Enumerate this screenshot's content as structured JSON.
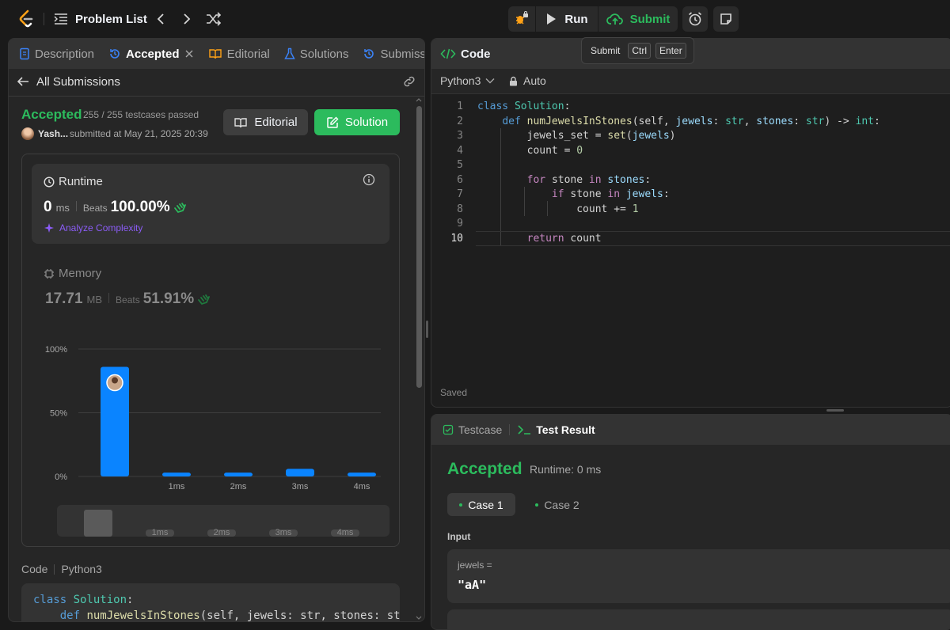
{
  "topbar": {
    "problem_list": "Problem List",
    "run": "Run",
    "submit": "Submit",
    "tooltip": {
      "label": "Submit",
      "key1": "Ctrl",
      "key2": "Enter"
    }
  },
  "left": {
    "tabs": {
      "description": "Description",
      "accepted": "Accepted",
      "editorial": "Editorial",
      "solutions": "Solutions",
      "submissions": "Submissio"
    },
    "all_submissions": "All Submissions",
    "status": "Accepted",
    "testcases": "255 / 255 testcases passed",
    "user": "Yash...",
    "submitted_at": "submitted at May 21, 2025 20:39",
    "editorial_btn": "Editorial",
    "solution_btn": "Solution",
    "runtime": {
      "label": "Runtime",
      "value": "0",
      "unit": "ms",
      "beats_label": "Beats",
      "beats": "100.00%",
      "analyze": "Analyze Complexity"
    },
    "memory": {
      "label": "Memory",
      "value": "17.71",
      "unit": "MB",
      "beats_label": "Beats",
      "beats": "51.91%"
    },
    "code_label": "Code",
    "code_lang": "Python3",
    "code_preview": [
      "class Solution:",
      "    def numJewelsInStones(self, jewels: str, stones: str"
    ]
  },
  "chart_data": {
    "type": "bar",
    "categories": [
      "",
      "1ms",
      "2ms",
      "3ms",
      "4ms"
    ],
    "values": [
      86,
      3,
      3,
      6,
      3
    ],
    "ylim": [
      0,
      100
    ],
    "yticks": [
      "100%",
      "50%",
      "0%"
    ],
    "minimap_labels": [
      "1ms",
      "2ms",
      "3ms",
      "4ms"
    ],
    "colors": {
      "bar": "#0a84ff",
      "grid": "#3e3e3e"
    }
  },
  "editor": {
    "title": "Code",
    "language": "Python3",
    "mode": "Auto",
    "saved": "Saved",
    "lines": [
      {
        "n": "1",
        "text": "class Solution:"
      },
      {
        "n": "2",
        "text": "    def numJewelsInStones(self, jewels: str, stones: str) -> int:"
      },
      {
        "n": "3",
        "text": "        jewels_set = set(jewels)"
      },
      {
        "n": "4",
        "text": "        count = 0"
      },
      {
        "n": "5",
        "text": ""
      },
      {
        "n": "6",
        "text": "        for stone in stones:"
      },
      {
        "n": "7",
        "text": "            if stone in jewels:"
      },
      {
        "n": "8",
        "text": "                count += 1"
      },
      {
        "n": "9",
        "text": ""
      },
      {
        "n": "10",
        "text": "        return count"
      }
    ]
  },
  "result": {
    "testcase_tab": "Testcase",
    "result_tab": "Test Result",
    "status": "Accepted",
    "runtime": "Runtime: 0 ms",
    "case1": "Case 1",
    "case2": "Case 2",
    "input_label": "Input",
    "var_name": "jewels =",
    "var_value": "\"aA\""
  }
}
